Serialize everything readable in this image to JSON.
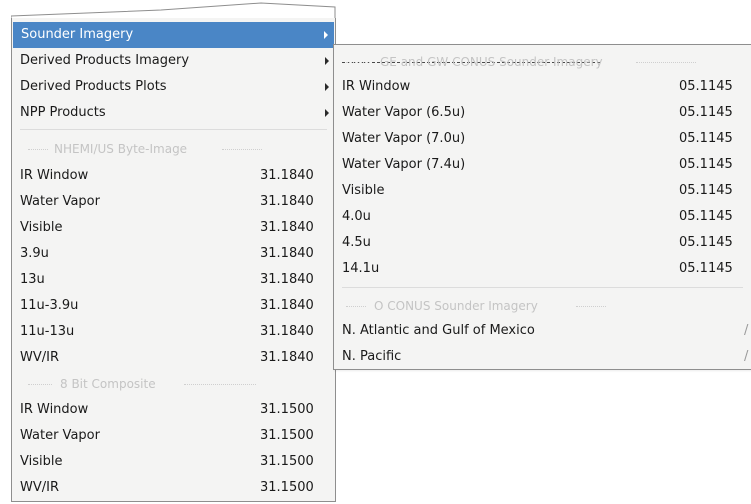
{
  "main_menu": {
    "submenus": [
      {
        "label": "Sounder Imagery",
        "selected": true
      },
      {
        "label": "Derived Products Imagery",
        "selected": false
      },
      {
        "label": "Derived Products Plots",
        "selected": false
      },
      {
        "label": "NPP Products",
        "selected": false
      }
    ],
    "section1_title": "NHEMI/US Byte-Image",
    "section1_items": [
      {
        "label": "IR Window",
        "value": "31.1840"
      },
      {
        "label": "Water Vapor",
        "value": "31.1840"
      },
      {
        "label": "Visible",
        "value": "31.1840"
      },
      {
        "label": "3.9u",
        "value": "31.1840"
      },
      {
        "label": "13u",
        "value": "31.1840"
      },
      {
        "label": "11u-3.9u",
        "value": "31.1840"
      },
      {
        "label": "11u-13u",
        "value": "31.1840"
      },
      {
        "label": "WV/IR",
        "value": "31.1840"
      }
    ],
    "section2_title": "8 Bit Composite",
    "section2_items": [
      {
        "label": "IR Window",
        "value": "31.1500"
      },
      {
        "label": "Water Vapor",
        "value": "31.1500"
      },
      {
        "label": "Visible",
        "value": "31.1500"
      },
      {
        "label": "WV/IR",
        "value": "31.1500"
      }
    ]
  },
  "sub_menu": {
    "section1_title": "GE and GW CONUS Sounder Imagery",
    "section1_items": [
      {
        "label": "IR Window",
        "value": "05.1145"
      },
      {
        "label": "Water Vapor (6.5u)",
        "value": "05.1145"
      },
      {
        "label": "Water Vapor (7.0u)",
        "value": "05.1145"
      },
      {
        "label": "Water Vapor (7.4u)",
        "value": "05.1145"
      },
      {
        "label": "Visible",
        "value": "05.1145"
      },
      {
        "label": "4.0u",
        "value": "05.1145"
      },
      {
        "label": "4.5u",
        "value": "05.1145"
      },
      {
        "label": "14.1u",
        "value": "05.1145"
      }
    ],
    "section2_title": "O CONUS Sounder Imagery",
    "section2_items": [
      {
        "label": "N. Atlantic and Gulf of Mexico",
        "value": "/"
      },
      {
        "label": "N. Pacific",
        "value": "/"
      }
    ]
  },
  "colors": {
    "selection": "#4a86c6",
    "menu_background": "#f4f4f3",
    "header_text": "#c4c4c4"
  }
}
